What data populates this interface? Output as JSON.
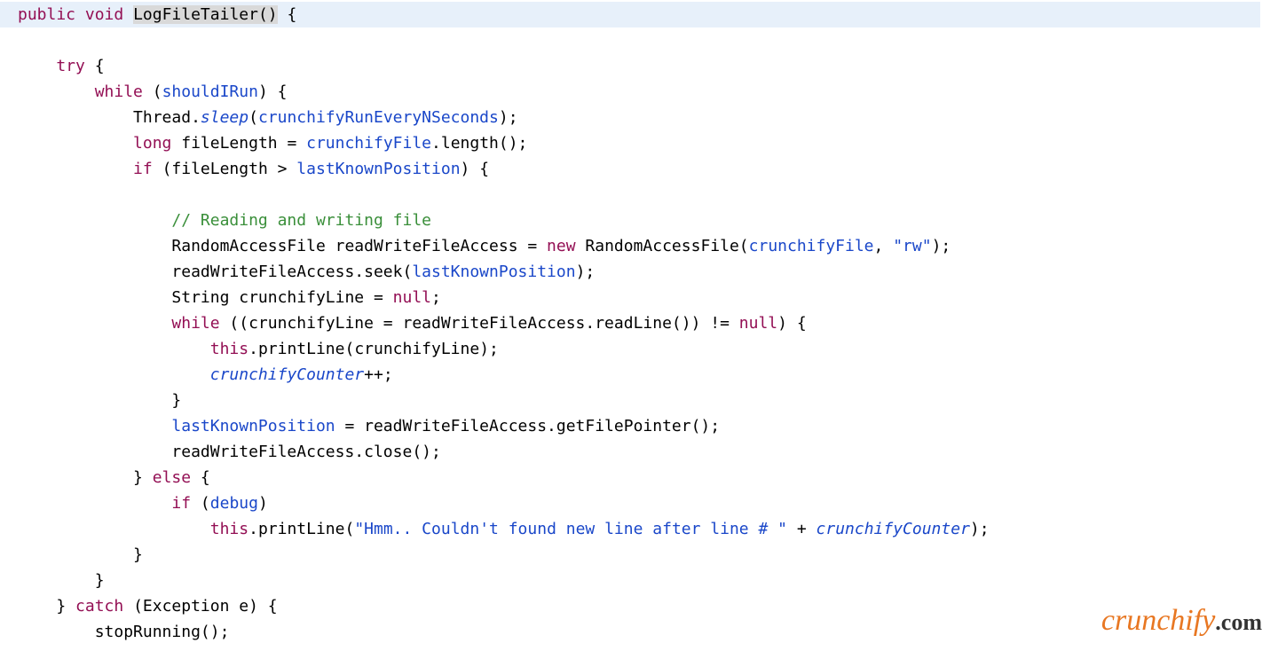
{
  "code": {
    "line1": {
      "kw_public": "public",
      "kw_void": "void",
      "method": "LogFileTailer",
      "parens": "()",
      "brace": " {"
    },
    "line2": {
      "kw_try": "try",
      "brace": " {"
    },
    "line3": {
      "kw_while": "while",
      "open": " (",
      "field": "shouldIRun",
      "close": ") {"
    },
    "line4": {
      "class": "Thread.",
      "method": "sleep",
      "open": "(",
      "field": "crunchifyRunEveryNSeconds",
      "close": ");"
    },
    "line5": {
      "kw_long": "long",
      "var": " fileLength = ",
      "field": "crunchifyFile",
      "call": ".length();"
    },
    "line6": {
      "kw_if": "if",
      "open": " (fileLength > ",
      "field": "lastKnownPosition",
      "close": ") {"
    },
    "line8": {
      "comment": "// Reading and writing file"
    },
    "line9": {
      "type1": "RandomAccessFile ",
      "var": "readWriteFileAccess = ",
      "kw_new": "new",
      "type2": " RandomAccessFile(",
      "field": "crunchifyFile",
      "comma": ", ",
      "str": "\"rw\"",
      "close": ");"
    },
    "line10": {
      "var": "readWriteFileAccess.seek(",
      "field": "lastKnownPosition",
      "close": ");"
    },
    "line11": {
      "type": "String crunchifyLine = ",
      "kw_null": "null",
      "semi": ";"
    },
    "line12": {
      "kw_while": "while",
      "open": " ((crunchifyLine = readWriteFileAccess.readLine()) != ",
      "kw_null": "null",
      "close": ") {"
    },
    "line13": {
      "kw_this": "this",
      "rest": ".printLine(crunchifyLine);"
    },
    "line14": {
      "field": "crunchifyCounter",
      "op": "++;"
    },
    "line15": {
      "brace": "}"
    },
    "line16": {
      "field": "lastKnownPosition",
      "rest": " = readWriteFileAccess.getFilePointer();"
    },
    "line17": {
      "text": "readWriteFileAccess.close();"
    },
    "line18": {
      "close": "} ",
      "kw_else": "else",
      "open": " {"
    },
    "line19": {
      "kw_if": "if",
      "open": " (",
      "field": "debug",
      "close": ")"
    },
    "line20": {
      "kw_this": "this",
      "call": ".printLine(",
      "str": "\"Hmm.. Couldn't found new line after line # \"",
      "plus": " + ",
      "field": "crunchifyCounter",
      "close": ");"
    },
    "line21": {
      "brace": "}"
    },
    "line22": {
      "brace": "}"
    },
    "line23": {
      "close": "} ",
      "kw_catch": "catch",
      "open": " (Exception e) {"
    },
    "line24": {
      "text": "stopRunning();"
    }
  },
  "watermark": {
    "brand": "crunchify",
    "dotcom": ".com"
  }
}
